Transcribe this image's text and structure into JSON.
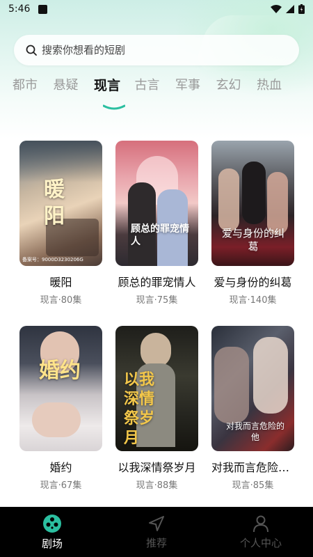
{
  "status_bar": {
    "time": "5:46"
  },
  "search": {
    "placeholder": "搜索你想看的短剧"
  },
  "tabs": [
    {
      "label": "都市"
    },
    {
      "label": "悬疑"
    },
    {
      "label": "现言",
      "active": true
    },
    {
      "label": "古言"
    },
    {
      "label": "军事"
    },
    {
      "label": "玄幻"
    },
    {
      "label": "热血"
    }
  ],
  "dramas": [
    {
      "title": "暖阳",
      "meta": "现言·80集",
      "cover_text": "暖阳",
      "cover_caption": "备案号：9000D3230206G"
    },
    {
      "title": "顾总的罪宠情人",
      "meta": "现言·75集",
      "cover_text": "顾总的罪宠情人"
    },
    {
      "title": "爱与身份的纠葛",
      "meta": "现言·140集",
      "cover_text": "爱与身份的纠葛"
    },
    {
      "title": "婚约",
      "meta": "现言·67集",
      "cover_text": "婚约"
    },
    {
      "title": "以我深情祭岁月",
      "meta": "现言·88集",
      "cover_text": "以我深情祭岁月"
    },
    {
      "title": "对我而言危险的他",
      "meta": "现言·85集",
      "cover_text": "对我而言危险的他"
    }
  ],
  "bottom_nav": [
    {
      "label": "剧场",
      "icon": "film-reel-icon",
      "active": true
    },
    {
      "label": "推荐",
      "icon": "send-arrow-icon"
    },
    {
      "label": "个人中心",
      "icon": "person-icon"
    }
  ],
  "colors": {
    "accent": "#2bbfa0",
    "nav_bg": "#000000"
  }
}
